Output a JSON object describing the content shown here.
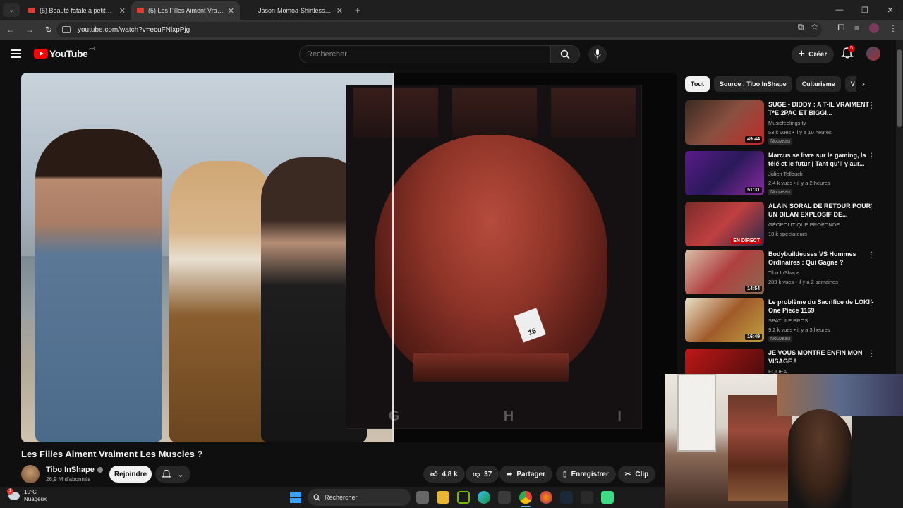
{
  "browser": {
    "tabs": [
      {
        "label": "(5) Beauté fatale à petits prix | ",
        "close": "✕",
        "active": false
      },
      {
        "label": "(5) Les Filles Aiment Vraiment L",
        "close": "✕",
        "active": true
      },
      {
        "label": "Jason-Momoa-Shirtless-05.jpg",
        "close": "✕",
        "active": false
      }
    ],
    "new_tab": "+",
    "url": "youtube.com/watch?v=ecuFNlxpPjg",
    "window": {
      "minimize": "—",
      "maximize": "❐",
      "close": "✕"
    }
  },
  "youtube": {
    "logo_text": "YouTube",
    "country_code": "FR",
    "search_placeholder": "Rechercher",
    "create_label": "Créer",
    "notification_count": "5"
  },
  "video": {
    "title": "Les Filles Aiment Vraiment Les Muscles ?",
    "overlay_letters": [
      "G",
      "H",
      "I"
    ],
    "bib_number": "16",
    "channel": {
      "name": "Tibo InShape",
      "subscribers": "26,9 M d'abonnés"
    },
    "join_label": "Rejoindre",
    "likes": "4,8 k",
    "dislikes": "37",
    "share_label": "Partager",
    "save_label": "Enregistrer",
    "clip_label": "Clip"
  },
  "chips": [
    "Tout",
    "Source : Tibo InShape",
    "Culturisme",
    "V"
  ],
  "recommendations": [
    {
      "title": "SUGE - DIDDY : A T-IL VRAIMENT T*E 2PAC ET BIGGI...",
      "channel": "Musicfeelings tv",
      "verified": true,
      "meta": "53 k vues • il y a 10 heures",
      "duration": "49:44",
      "badge": "Nouveau",
      "thumb": "linear-gradient(135deg,#3a2a22,#8a5040 50%,#c02a2a)"
    },
    {
      "title": "Marcus se livre sur le gaming, la télé et le futur | Tant qu'il y aur...",
      "channel": "Julien Tellouck",
      "verified": false,
      "meta": "2,4 k vues • il y a 2 heures",
      "duration": "51:31",
      "badge": "Nouveau",
      "thumb": "linear-gradient(135deg,#5a1a8a,#2a1a5a 50%,#8a2aa0)"
    },
    {
      "title": "ALAIN SORAL DE RETOUR POUR UN BILAN EXPLOSIF DE...",
      "channel": "GÉOPOLITIQUE PROFONDE",
      "verified": true,
      "meta": "10 k spectateurs",
      "duration": "EN DIRECT",
      "badge": "",
      "thumb": "linear-gradient(135deg,#7a2a2a,#c04040 50%,#2a2a4a)"
    },
    {
      "title": "Bodybuildeuses VS Hommes Ordinaires : Qui Gagne ?",
      "channel": "Tibo InShape",
      "verified": true,
      "meta": "289 k vues • il y a 2 semaines",
      "duration": "14:54",
      "badge": "",
      "thumb": "linear-gradient(135deg,#d8c0a8,#b04040 50%,#8a6a50)"
    },
    {
      "title": "Le problème du Sacrifice de LOKI - One Piece 1169",
      "channel": "SPATULE BROS",
      "verified": false,
      "meta": "9,2 k vues • il y a 3 heures",
      "duration": "16:49",
      "badge": "Nouveau",
      "thumb": "linear-gradient(135deg,#e8e0c8,#a05a2a 50%,#c0a040)"
    },
    {
      "title": "JE VOUS MONTRE ENFIN MON VISAGE !",
      "channel": "EQUEA",
      "verified": true,
      "meta": "",
      "duration": "",
      "badge": "",
      "thumb": "linear-gradient(135deg,#c01818,#3a0a0a)"
    }
  ],
  "taskbar": {
    "weather_temp": "10°C",
    "weather_desc": "Nuageux",
    "weather_badge": "1",
    "search_label": "Rechercher"
  }
}
